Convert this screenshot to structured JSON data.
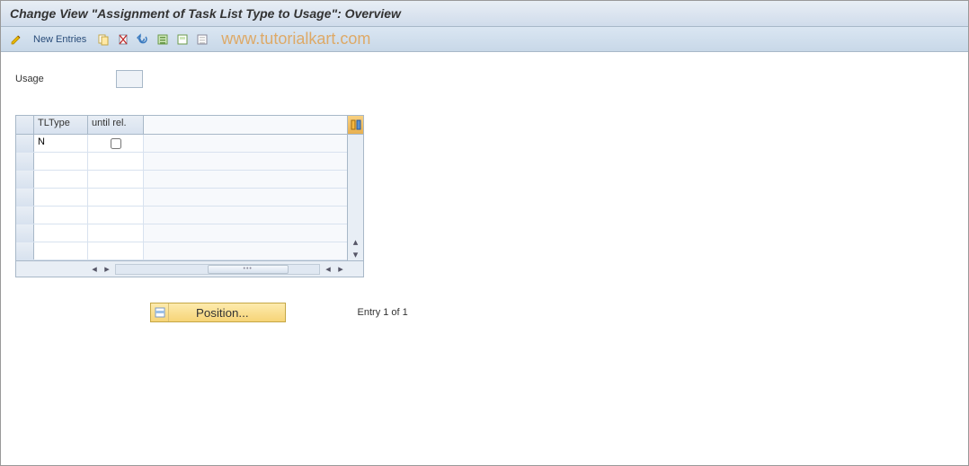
{
  "title": "Change View \"Assignment of Task List Type to Usage\": Overview",
  "toolbar": {
    "new_entries": "New Entries"
  },
  "watermark": "www.tutorialkart.com",
  "usage": {
    "label": "Usage",
    "value": ""
  },
  "grid": {
    "columns": {
      "c1": "TLType",
      "c2": "until rel."
    },
    "rows": [
      {
        "tltype": "N",
        "until_rel": false
      },
      {
        "tltype": "",
        "until_rel": null
      },
      {
        "tltype": "",
        "until_rel": null
      },
      {
        "tltype": "",
        "until_rel": null
      },
      {
        "tltype": "",
        "until_rel": null
      },
      {
        "tltype": "",
        "until_rel": null
      },
      {
        "tltype": "",
        "until_rel": null
      }
    ]
  },
  "footer": {
    "position_label": "Position...",
    "entry_text": "Entry 1 of 1"
  }
}
